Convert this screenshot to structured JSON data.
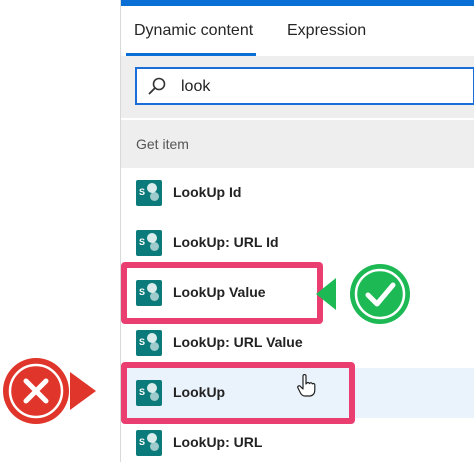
{
  "tabs": [
    {
      "label": "Dynamic content",
      "active": true
    },
    {
      "label": "Expression",
      "active": false
    }
  ],
  "search": {
    "value": "look",
    "icon": "search-icon"
  },
  "section": {
    "title": "Get item"
  },
  "items": [
    {
      "label": "LookUp Id",
      "icon": "sharepoint-icon"
    },
    {
      "label": "LookUp: URL Id",
      "icon": "sharepoint-icon"
    },
    {
      "label": "LookUp Value",
      "icon": "sharepoint-icon",
      "annotation": "correct"
    },
    {
      "label": "LookUp: URL Value",
      "icon": "sharepoint-icon"
    },
    {
      "label": "LookUp",
      "icon": "sharepoint-icon",
      "annotation": "incorrect",
      "hovered": true
    },
    {
      "label": "LookUp: URL",
      "icon": "sharepoint-icon"
    }
  ],
  "colors": {
    "accent": "#0a6fd4",
    "highlight": "#ea3e71",
    "check_green": "#1db954",
    "cross_red": "#e0352b",
    "sharepoint_teal": "#0b7a7a"
  }
}
